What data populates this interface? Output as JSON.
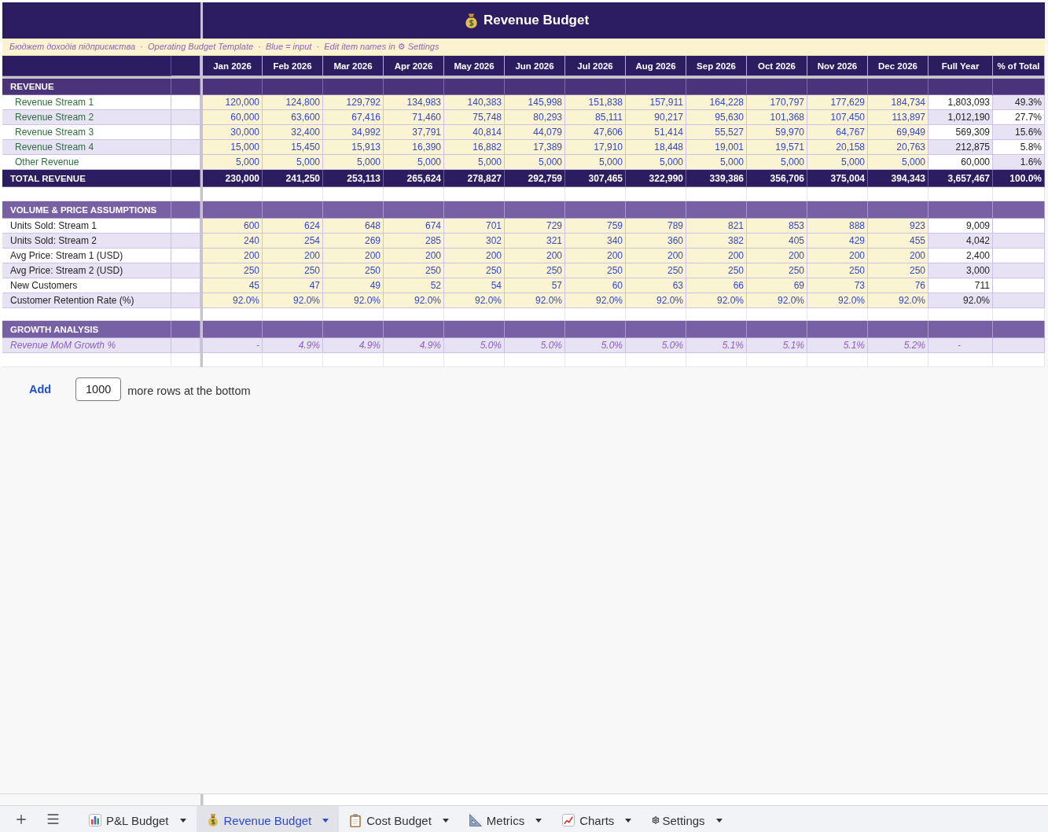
{
  "title": "Revenue Budget",
  "subtitle": "Бюджет доходів підприємства  ·  Operating Budget Template  ·  Blue = input  ·  Edit item names in ⚙ Settings",
  "columns": [
    "Jan 2026",
    "Feb 2026",
    "Mar 2026",
    "Apr 2026",
    "May 2026",
    "Jun 2026",
    "Jul 2026",
    "Aug 2026",
    "Sep 2026",
    "Oct 2026",
    "Nov 2026",
    "Dec 2026",
    "Full Year",
    "% of Total"
  ],
  "sections": [
    {
      "kind": "revenue",
      "title": "REVENUE",
      "rows": [
        {
          "label": "Revenue Stream 1",
          "values": [
            "120,000",
            "124,800",
            "129,792",
            "134,983",
            "140,383",
            "145,998",
            "151,838",
            "157,911",
            "164,228",
            "170,797",
            "177,629",
            "184,734"
          ],
          "full_year": "1,803,093",
          "share": "49.3%"
        },
        {
          "label": "Revenue Stream 2",
          "values": [
            "60,000",
            "63,600",
            "67,416",
            "71,460",
            "75,748",
            "80,293",
            "85,111",
            "90,217",
            "95,630",
            "101,368",
            "107,450",
            "113,897"
          ],
          "full_year": "1,012,190",
          "share": "27.7%"
        },
        {
          "label": "Revenue Stream 3",
          "values": [
            "30,000",
            "32,400",
            "34,992",
            "37,791",
            "40,814",
            "44,079",
            "47,606",
            "51,414",
            "55,527",
            "59,970",
            "64,767",
            "69,949"
          ],
          "full_year": "569,309",
          "share": "15.6%"
        },
        {
          "label": "Revenue Stream 4",
          "values": [
            "15,000",
            "15,450",
            "15,913",
            "16,390",
            "16,882",
            "17,389",
            "17,910",
            "18,448",
            "19,001",
            "19,571",
            "20,158",
            "20,763"
          ],
          "full_year": "212,875",
          "share": "5.8%"
        },
        {
          "label": "Other Revenue",
          "values": [
            "5,000",
            "5,000",
            "5,000",
            "5,000",
            "5,000",
            "5,000",
            "5,000",
            "5,000",
            "5,000",
            "5,000",
            "5,000",
            "5,000"
          ],
          "full_year": "60,000",
          "share": "1.6%"
        }
      ],
      "total": {
        "label": "TOTAL REVENUE",
        "values": [
          "230,000",
          "241,250",
          "253,113",
          "265,624",
          "278,827",
          "292,759",
          "307,465",
          "322,990",
          "339,386",
          "356,706",
          "375,004",
          "394,343"
        ],
        "full_year": "3,657,467",
        "share": "100.0%"
      }
    },
    {
      "kind": "assumptions",
      "title": "VOLUME & PRICE ASSUMPTIONS",
      "rows": [
        {
          "label": "Units Sold: Stream 1",
          "values": [
            "600",
            "624",
            "648",
            "674",
            "701",
            "729",
            "759",
            "789",
            "821",
            "853",
            "888",
            "923"
          ],
          "full_year": "9,009"
        },
        {
          "label": "Units Sold: Stream 2",
          "values": [
            "240",
            "254",
            "269",
            "285",
            "302",
            "321",
            "340",
            "360",
            "382",
            "405",
            "429",
            "455"
          ],
          "full_year": "4,042"
        },
        {
          "label": "Avg Price: Stream 1 (USD)",
          "values": [
            "200",
            "200",
            "200",
            "200",
            "200",
            "200",
            "200",
            "200",
            "200",
            "200",
            "200",
            "200"
          ],
          "full_year": "2,400"
        },
        {
          "label": "Avg Price: Stream 2 (USD)",
          "values": [
            "250",
            "250",
            "250",
            "250",
            "250",
            "250",
            "250",
            "250",
            "250",
            "250",
            "250",
            "250"
          ],
          "full_year": "3,000"
        },
        {
          "label": "New Customers",
          "values": [
            "45",
            "47",
            "49",
            "52",
            "54",
            "57",
            "60",
            "63",
            "66",
            "69",
            "73",
            "76"
          ],
          "full_year": "711"
        },
        {
          "label": "Customer Retention Rate (%)",
          "values": [
            "92.0%",
            "92.0%",
            "92.0%",
            "92.0%",
            "92.0%",
            "92.0%",
            "92.0%",
            "92.0%",
            "92.0%",
            "92.0%",
            "92.0%",
            "92.0%"
          ],
          "full_year": "92.0%"
        }
      ]
    },
    {
      "kind": "growth",
      "title": "GROWTH ANALYSIS",
      "rows": [
        {
          "label": "Revenue MoM Growth %",
          "values": [
            "-",
            "4.9%",
            "4.9%",
            "4.9%",
            "5.0%",
            "5.0%",
            "5.0%",
            "5.0%",
            "5.1%",
            "5.1%",
            "5.1%",
            "5.2%"
          ],
          "full_year": "-"
        }
      ]
    }
  ],
  "add_rows": {
    "link": "Add",
    "value": "1000",
    "text": "more rows at the bottom"
  },
  "sheet_tabs": [
    {
      "label": "P&L Budget",
      "selected": false
    },
    {
      "label": "Revenue Budget",
      "selected": true
    },
    {
      "label": "Cost Budget",
      "selected": false
    },
    {
      "label": "Metrics",
      "selected": false
    },
    {
      "label": "Charts",
      "selected": false
    },
    {
      "label": "Settings",
      "selected": false
    }
  ]
}
